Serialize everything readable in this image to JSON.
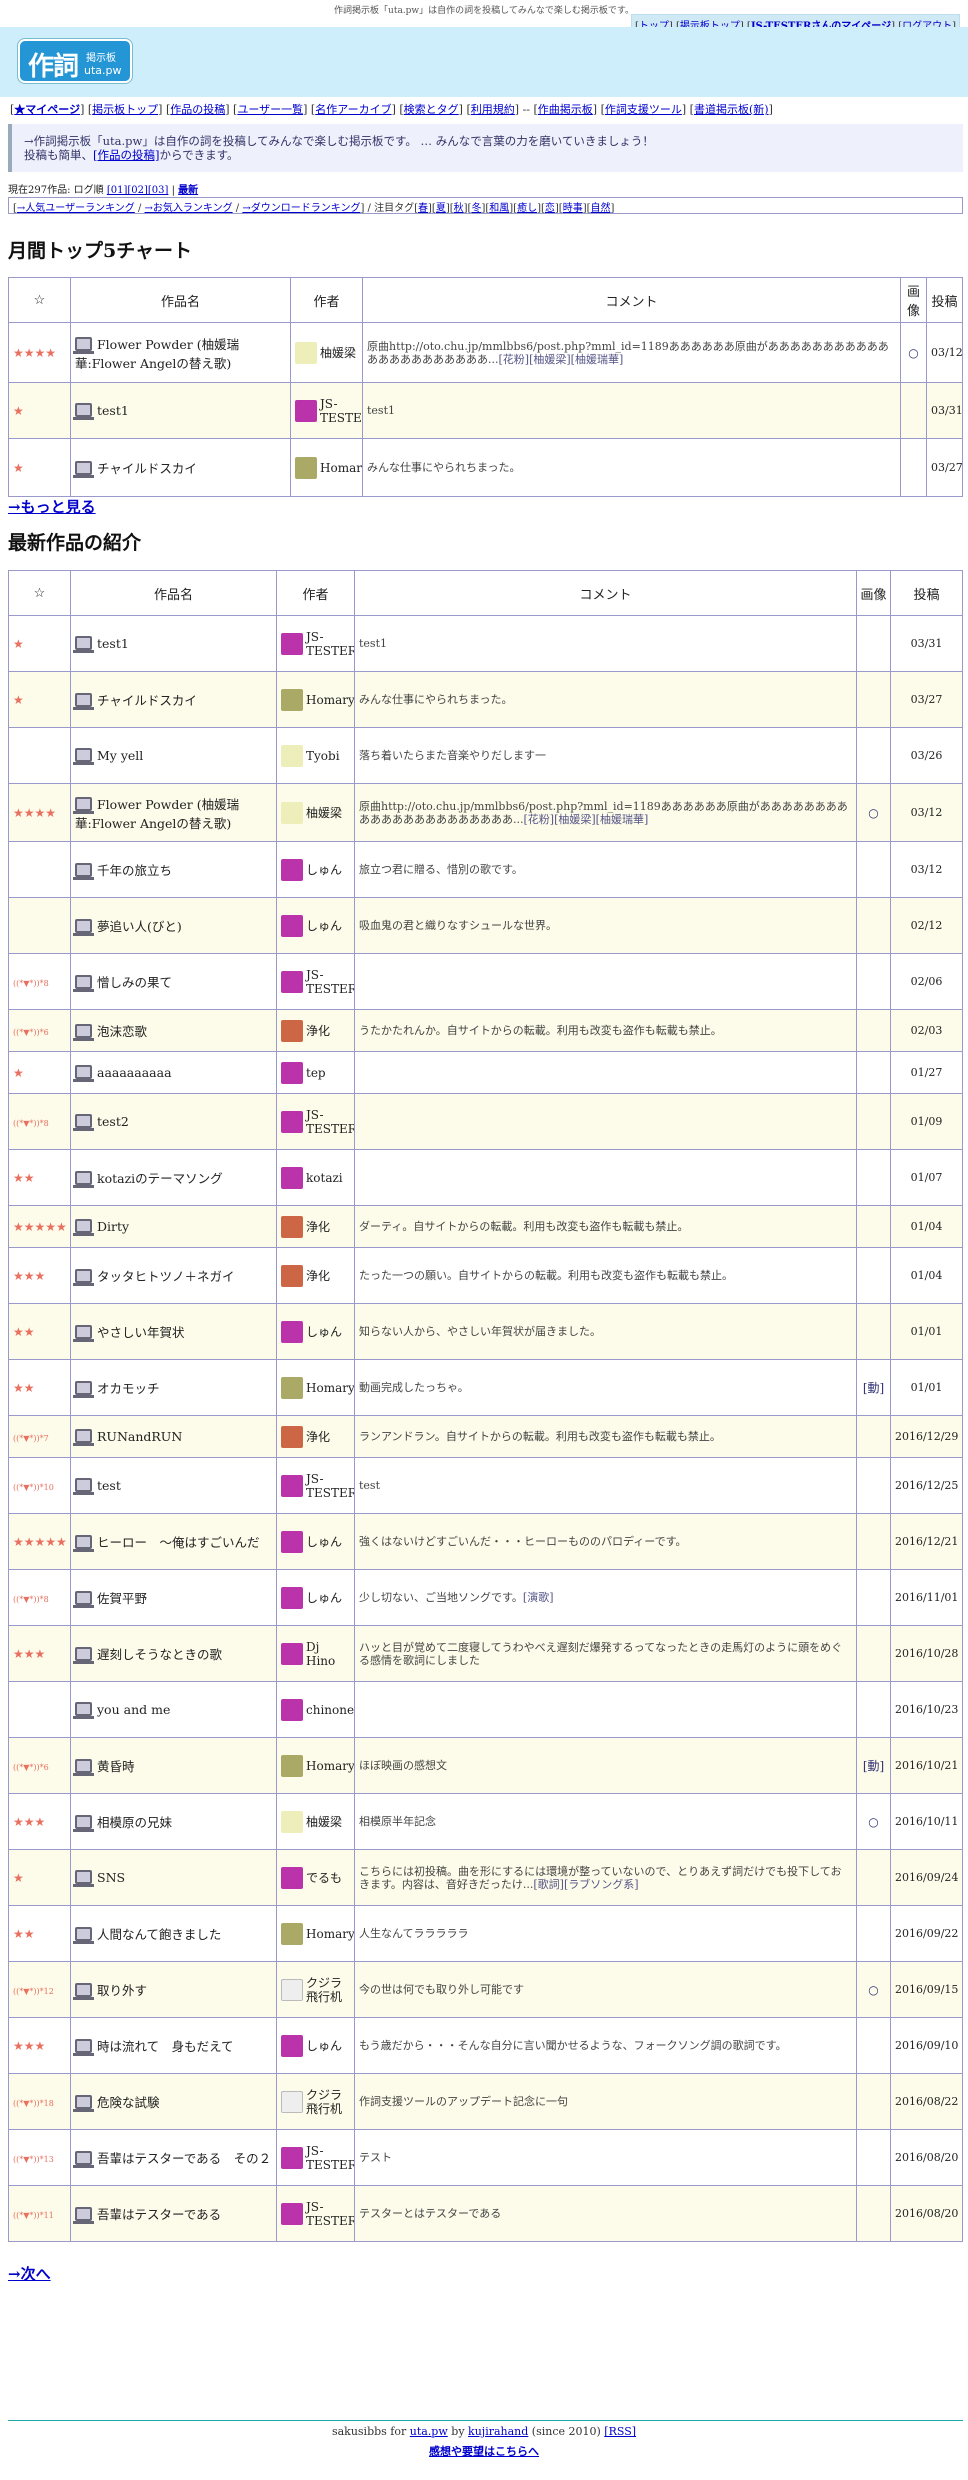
{
  "tagline": "作詞掲示板「uta.pw」は自作の詞を投稿してみんなで楽しむ掲示板です。",
  "topnav": {
    "items": [
      "トップ",
      "掲示板トップ",
      "JS-TESTERさんのマイページ",
      "ログアウト"
    ]
  },
  "logo": {
    "main": "作詞",
    "sub1": "掲示板",
    "sub2": "uta.pw"
  },
  "mainnav": {
    "items": [
      "★マイページ",
      "掲示板トップ",
      "作品の投稿",
      "ユーザー一覧",
      "名作アーカイブ",
      "検索とタグ",
      "利用規約",
      "作曲掲示板",
      "作詞支援ツール",
      "書道掲示板(新)"
    ],
    "sep": "--"
  },
  "intro": {
    "line1": "→作詞掲示板「uta.pw」は自作の詞を投稿してみんなで楽しむ掲示板です。 … みんなで言葉の力を磨いていきましょう！",
    "line2a": "投稿も簡単、",
    "line2link": "[作品の投稿]",
    "line2b": "からできます。"
  },
  "status": {
    "prefix": "現在297作品: ログ順 ",
    "pages": "[01][02][03]",
    "latest": "最新"
  },
  "rankbar": {
    "links": [
      "→人気ユーザーランキング",
      "→お気入ランキング",
      "→ダウンロードランキング"
    ],
    "tag_label": "/ 注目タグ",
    "tags": [
      "春",
      "夏",
      "秋",
      "冬",
      "和風",
      "癒し",
      "恋",
      "時事",
      "自然"
    ]
  },
  "monthly": {
    "heading": "月間トップ5チャート",
    "more": "→もっと見る",
    "headers": {
      "star": "☆",
      "title": "作品名",
      "author": "作者",
      "comment": "コメント",
      "image": "画像",
      "date": "投稿"
    },
    "rows": [
      {
        "stars": "★★★★",
        "title": "Flower Powder (柚媛瑞華:Flower Angelの替え歌)",
        "author": "柚媛梁",
        "avatar": "y",
        "comment": "原曲http://oto.chu.jp/mmlbbs6/post.php?mml_id=1189ああああああ原曲がああああああああああああああああああああああ...",
        "tags": "[花粉][柚媛梁][柚媛瑞華]",
        "img": "○",
        "date": "03/12"
      },
      {
        "stars": "★",
        "title": "test1",
        "author": "JS-TESTER",
        "avatar": "p",
        "comment": "test1",
        "tags": "",
        "img": "",
        "date": "03/31"
      },
      {
        "stars": "★",
        "title": "チャイルドスカイ",
        "author": "Homary",
        "avatar": "o",
        "comment": "みんな仕事にやられちまった。",
        "tags": "",
        "img": "",
        "date": "03/27"
      }
    ]
  },
  "latest": {
    "heading": "最新作品の紹介",
    "next": "→次へ",
    "headers": {
      "star": "☆",
      "title": "作品名",
      "author": "作者",
      "comment": "コメント",
      "image": "画像",
      "date": "投稿"
    },
    "rows": [
      {
        "stars": "★",
        "sm": false,
        "title": "test1",
        "author": "JS-TESTER",
        "avatar": "p",
        "comment": "test1",
        "tags": "",
        "img": "",
        "date": "03/31"
      },
      {
        "stars": "★",
        "sm": false,
        "title": "チャイルドスカイ",
        "author": "Homary",
        "avatar": "o",
        "comment": "みんな仕事にやられちまった。",
        "tags": "",
        "img": "",
        "date": "03/27"
      },
      {
        "stars": "",
        "sm": false,
        "title": "My yell",
        "author": "Tyobi",
        "avatar": "y",
        "comment": "落ち着いたらまた音楽やりだします一",
        "tags": "",
        "img": "",
        "date": "03/26"
      },
      {
        "stars": "★★★★",
        "sm": false,
        "title": "Flower Powder (柚媛瑞華:Flower Angelの替え歌)",
        "author": "柚媛梁",
        "avatar": "y",
        "comment": "原曲http://oto.chu.jp/mmlbbs6/post.php?mml_id=1189ああああああ原曲がああああああああああああああああああああああ...",
        "tags": "[花粉][柚媛梁][柚媛瑞華]",
        "img": "○",
        "date": "03/12"
      },
      {
        "stars": "",
        "sm": false,
        "title": "千年の旅立ち",
        "author": "しゅん",
        "avatar": "p",
        "comment": "旅立つ君に贈る、惜別の歌です。",
        "tags": "",
        "img": "",
        "date": "03/12"
      },
      {
        "stars": "",
        "sm": false,
        "title": "夢追い人(びと)",
        "author": "しゅん",
        "avatar": "p",
        "comment": "吸血鬼の君と織りなすシュールな世界。",
        "tags": "",
        "img": "",
        "date": "02/12"
      },
      {
        "stars": "((*▼*))*8",
        "sm": true,
        "title": "憎しみの果て",
        "author": "JS-TESTER",
        "avatar": "p",
        "comment": "",
        "tags": "",
        "img": "",
        "date": "02/06"
      },
      {
        "stars": "((*▼*))*6",
        "sm": true,
        "title": "泡沫恋歌",
        "author": "浄化",
        "avatar": "r",
        "comment": "うたかたれんか。自サイトからの転載。利用も改変も盗作も転載も禁止。",
        "tags": "",
        "img": "",
        "date": "02/03"
      },
      {
        "stars": "★",
        "sm": false,
        "title": "aaaaaaaaaa",
        "author": "tep",
        "avatar": "p",
        "comment": "",
        "tags": "",
        "img": "",
        "date": "01/27"
      },
      {
        "stars": "((*▼*))*8",
        "sm": true,
        "title": "test2",
        "author": "JS-TESTER",
        "avatar": "p",
        "comment": "",
        "tags": "",
        "img": "",
        "date": "01/09"
      },
      {
        "stars": "★★",
        "sm": false,
        "title": "kotaziのテーマソング",
        "author": "kotazi",
        "avatar": "p",
        "comment": "",
        "tags": "",
        "img": "",
        "date": "01/07"
      },
      {
        "stars": "★★★★★",
        "sm": false,
        "title": "Dirty",
        "author": "浄化",
        "avatar": "r",
        "comment": "ダーティ。自サイトからの転載。利用も改変も盗作も転載も禁止。",
        "tags": "",
        "img": "",
        "date": "01/04"
      },
      {
        "stars": "★★★",
        "sm": false,
        "title": "タッタヒトツノ＋ネガイ",
        "author": "浄化",
        "avatar": "r",
        "comment": "たった一つの願い。自サイトからの転載。利用も改変も盗作も転載も禁止。",
        "tags": "",
        "img": "",
        "date": "01/04"
      },
      {
        "stars": "★★",
        "sm": false,
        "title": "やさしい年賀状",
        "author": "しゅん",
        "avatar": "p",
        "comment": "知らない人から、やさしい年賀状が届きました。",
        "tags": "",
        "img": "",
        "date": "01/01"
      },
      {
        "stars": "★★",
        "sm": false,
        "title": "オカモッチ",
        "author": "Homary",
        "avatar": "o",
        "comment": "動画完成したっちゃ。",
        "tags": "",
        "img": "[動]",
        "date": "01/01"
      },
      {
        "stars": "((*▼*))*7",
        "sm": true,
        "title": "RUNandRUN",
        "author": "浄化",
        "avatar": "r",
        "comment": "ランアンドラン。自サイトからの転載。利用も改変も盗作も転載も禁止。",
        "tags": "",
        "img": "",
        "date": "2016/12/29"
      },
      {
        "stars": "((*▼*))*10",
        "sm": true,
        "title": "test",
        "author": "JS-TESTER",
        "avatar": "p",
        "comment": "test",
        "tags": "",
        "img": "",
        "date": "2016/12/25"
      },
      {
        "stars": "★★★★★",
        "sm": false,
        "title": "ヒーロー　〜俺はすごいんだ",
        "author": "しゅん",
        "avatar": "p",
        "comment": "強くはないけどすごいんだ・・・ヒーローもののパロディーです。",
        "tags": "",
        "img": "",
        "date": "2016/12/21"
      },
      {
        "stars": "((*▼*))*8",
        "sm": true,
        "title": "佐賀平野",
        "author": "しゅん",
        "avatar": "p",
        "comment": "少し切ない、ご当地ソングです。",
        "tags": "[演歌]",
        "img": "",
        "date": "2016/11/01"
      },
      {
        "stars": "★★★",
        "sm": false,
        "title": "遅刻しそうなときの歌",
        "author": "Dj Hino",
        "avatar": "p",
        "comment": "ハッと目が覚めて二度寝してうわやべえ遅刻だ爆発するってなったときの走馬灯のように頭をめぐる感情を歌詞にしました",
        "tags": "",
        "img": "",
        "date": "2016/10/28"
      },
      {
        "stars": "",
        "sm": false,
        "title": "you and me",
        "author": "chinone",
        "avatar": "p",
        "comment": "",
        "tags": "",
        "img": "",
        "date": "2016/10/23"
      },
      {
        "stars": "((*▼*))*6",
        "sm": true,
        "title": "黄昏時",
        "author": "Homary",
        "avatar": "o",
        "comment": "ほぼ映画の感想文",
        "tags": "",
        "img": "[動]",
        "date": "2016/10/21"
      },
      {
        "stars": "★★★",
        "sm": false,
        "title": "相模原の兄妹",
        "author": "柚媛梁",
        "avatar": "y",
        "comment": "相模原半年記念",
        "tags": "",
        "img": "○",
        "date": "2016/10/11"
      },
      {
        "stars": "★",
        "sm": false,
        "title": "SNS",
        "author": "でるも",
        "avatar": "p",
        "comment": "こちらには初投稿。曲を形にするには環境が整っていないので、とりあえず詞だけでも投下しておきます。内容は、音好きだったけ...",
        "tags": "[歌詞][ラブソング系]",
        "img": "",
        "date": "2016/09/24"
      },
      {
        "stars": "★★",
        "sm": false,
        "title": "人間なんて飽きました",
        "author": "Homary",
        "avatar": "o",
        "comment": "人生なんてラララララ",
        "tags": "",
        "img": "",
        "date": "2016/09/22"
      },
      {
        "stars": "((*▼*))*12",
        "sm": true,
        "title": "取り外す",
        "author": "クジラ飛行机",
        "avatar": "b",
        "comment": "今の世は何でも取り外し可能です",
        "tags": "",
        "img": "○",
        "date": "2016/09/15"
      },
      {
        "stars": "★★★",
        "sm": false,
        "title": "時は流れて　身もだえて",
        "author": "しゅん",
        "avatar": "p",
        "comment": "もう歳だから・・・そんな自分に言い聞かせるような、フォークソング調の歌詞です。",
        "tags": "",
        "img": "",
        "date": "2016/09/10"
      },
      {
        "stars": "((*▼*))*18",
        "sm": true,
        "title": "危険な試験",
        "author": "クジラ飛行机",
        "avatar": "b",
        "comment": "作詞支援ツールのアップデート記念に一句",
        "tags": "",
        "img": "",
        "date": "2016/08/22"
      },
      {
        "stars": "((*▼*))*13",
        "sm": true,
        "title": "吾輩はテスターである　その２",
        "author": "JS-TESTER",
        "avatar": "p",
        "comment": "テスト",
        "tags": "",
        "img": "",
        "date": "2016/08/20"
      },
      {
        "stars": "((*▼*))*11",
        "sm": true,
        "title": "吾輩はテスターである",
        "author": "JS-TESTER",
        "avatar": "p",
        "comment": "テスターとはテスターである",
        "tags": "",
        "img": "",
        "date": "2016/08/20"
      }
    ]
  },
  "footer": {
    "line1a": "sakusibbs for ",
    "site": "uta.pw",
    "by": " by ",
    "author": "kujirahand",
    "since": " (since 2010) ",
    "rss": "[RSS]",
    "feedback": "感想や要望はこちらへ"
  }
}
